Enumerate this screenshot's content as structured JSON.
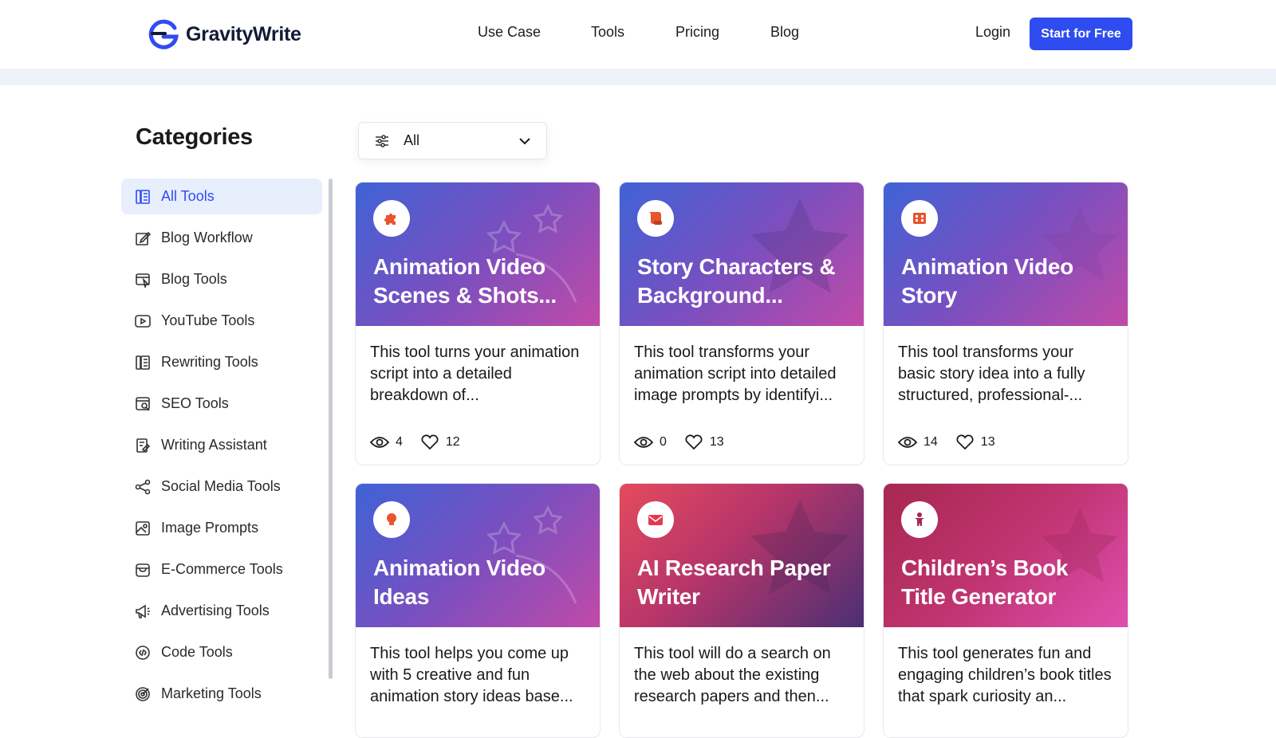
{
  "brand": {
    "name": "GravityWrite",
    "accent": "#2f4cf0"
  },
  "nav": [
    {
      "label": "Use Case"
    },
    {
      "label": "Tools"
    },
    {
      "label": "Pricing"
    },
    {
      "label": "Blog"
    }
  ],
  "auth": {
    "login": "Login",
    "cta": "Start for Free"
  },
  "sidebar": {
    "title": "Categories",
    "items": [
      {
        "label": "All Tools",
        "icon": "grid-book-icon",
        "active": true
      },
      {
        "label": "Blog Workflow",
        "icon": "edit-note-icon"
      },
      {
        "label": "Blog Tools",
        "icon": "browser-cursor-icon"
      },
      {
        "label": "YouTube Tools",
        "icon": "play-button-icon"
      },
      {
        "label": "Rewriting Tools",
        "icon": "book-icon"
      },
      {
        "label": "SEO Tools",
        "icon": "browser-search-icon"
      },
      {
        "label": "Writing Assistant",
        "icon": "document-pen-icon"
      },
      {
        "label": "Social Media Tools",
        "icon": "share-nodes-icon"
      },
      {
        "label": "Image Prompts",
        "icon": "image-icon"
      },
      {
        "label": "E-Commerce Tools",
        "icon": "storefront-icon"
      },
      {
        "label": "Advertising Tools",
        "icon": "megaphone-icon"
      },
      {
        "label": "Code Tools",
        "icon": "code-circle-icon"
      },
      {
        "label": "Marketing Tools",
        "icon": "target-icon"
      }
    ]
  },
  "filter": {
    "selected": "All"
  },
  "cards": [
    {
      "title": "Animation Video Scenes & Shots...",
      "desc": "This tool turns your animation script into a detailed breakdown of...",
      "views": "4",
      "likes": "12",
      "icon": "puzzle-icon",
      "theme": "bluepurple"
    },
    {
      "title": "Story Characters & Background...",
      "desc": "This tool transforms your animation script into detailed image prompts by identifyi...",
      "views": "0",
      "likes": "13",
      "icon": "scroll-icon",
      "theme": "bluepurple"
    },
    {
      "title": "Animation Video Story",
      "desc": "This tool transforms your basic story idea into a fully structured, professional-...",
      "views": "14",
      "likes": "13",
      "icon": "film-icon",
      "theme": "bluepurple"
    },
    {
      "title": "Animation Video Ideas",
      "desc": "This tool helps you come up with 5 creative and fun animation story ideas base...",
      "views": "",
      "likes": "",
      "icon": "lightbulb-icon",
      "theme": "bluepurple"
    },
    {
      "title": "AI Research Paper Writer",
      "desc": "This tool will do a search on the web about the existing research papers and then...",
      "views": "",
      "likes": "",
      "icon": "envelope-icon",
      "theme": "red"
    },
    {
      "title": "Children’s Book Title Generator",
      "desc": "This tool generates fun and engaging children’s book titles that spark curiosity an...",
      "views": "",
      "likes": "",
      "icon": "child-icon",
      "theme": "pink"
    }
  ]
}
